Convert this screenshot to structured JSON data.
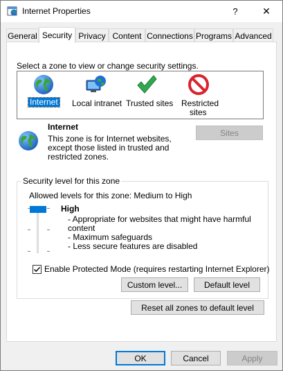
{
  "window": {
    "title": "Internet Properties",
    "help_glyph": "?",
    "close_glyph": "✕"
  },
  "tabs": [
    {
      "label": "General"
    },
    {
      "label": "Security"
    },
    {
      "label": "Privacy"
    },
    {
      "label": "Content"
    },
    {
      "label": "Connections"
    },
    {
      "label": "Programs"
    },
    {
      "label": "Advanced"
    }
  ],
  "active_tab": "Security",
  "zones": {
    "prompt": "Select a zone to view or change security settings.",
    "items": [
      {
        "label": "Internet",
        "icon": "globe-icon"
      },
      {
        "label": "Local intranet",
        "icon": "intranet-icon"
      },
      {
        "label": "Trusted sites",
        "icon": "checkmark-icon"
      },
      {
        "label": "Restricted sites",
        "label_line1": "Restricted",
        "label_line2": "sites",
        "icon": "restricted-icon"
      }
    ],
    "selected": "Internet"
  },
  "zone_detail": {
    "name": "Internet",
    "desc_line1": "This zone is for Internet websites,",
    "desc_line2": "except those listed in trusted and",
    "desc_line3": "restricted zones.",
    "sites_button": "Sites"
  },
  "security_level": {
    "group_title": "Security level for this zone",
    "allowed": "Allowed levels for this zone: Medium to High",
    "level_name": "High",
    "slider_level": "High",
    "items": [
      "- Appropriate for websites that might have harmful",
      "content",
      "- Maximum safeguards",
      "- Less secure features are disabled"
    ],
    "protected_mode_label": "Enable Protected Mode (requires restarting Internet Explorer)",
    "protected_mode_checked": true,
    "custom_level_button": "Custom level...",
    "default_level_button": "Default level",
    "reset_all_button": "Reset all zones to default level"
  },
  "footer": {
    "ok": "OK",
    "cancel": "Cancel",
    "apply": "Apply"
  },
  "colors": {
    "accent": "#0078d7",
    "globe_blue": "#1e6fd9",
    "globe_green": "#3aa635",
    "check_green": "#2fa84f",
    "restricted_red": "#d9232e"
  }
}
